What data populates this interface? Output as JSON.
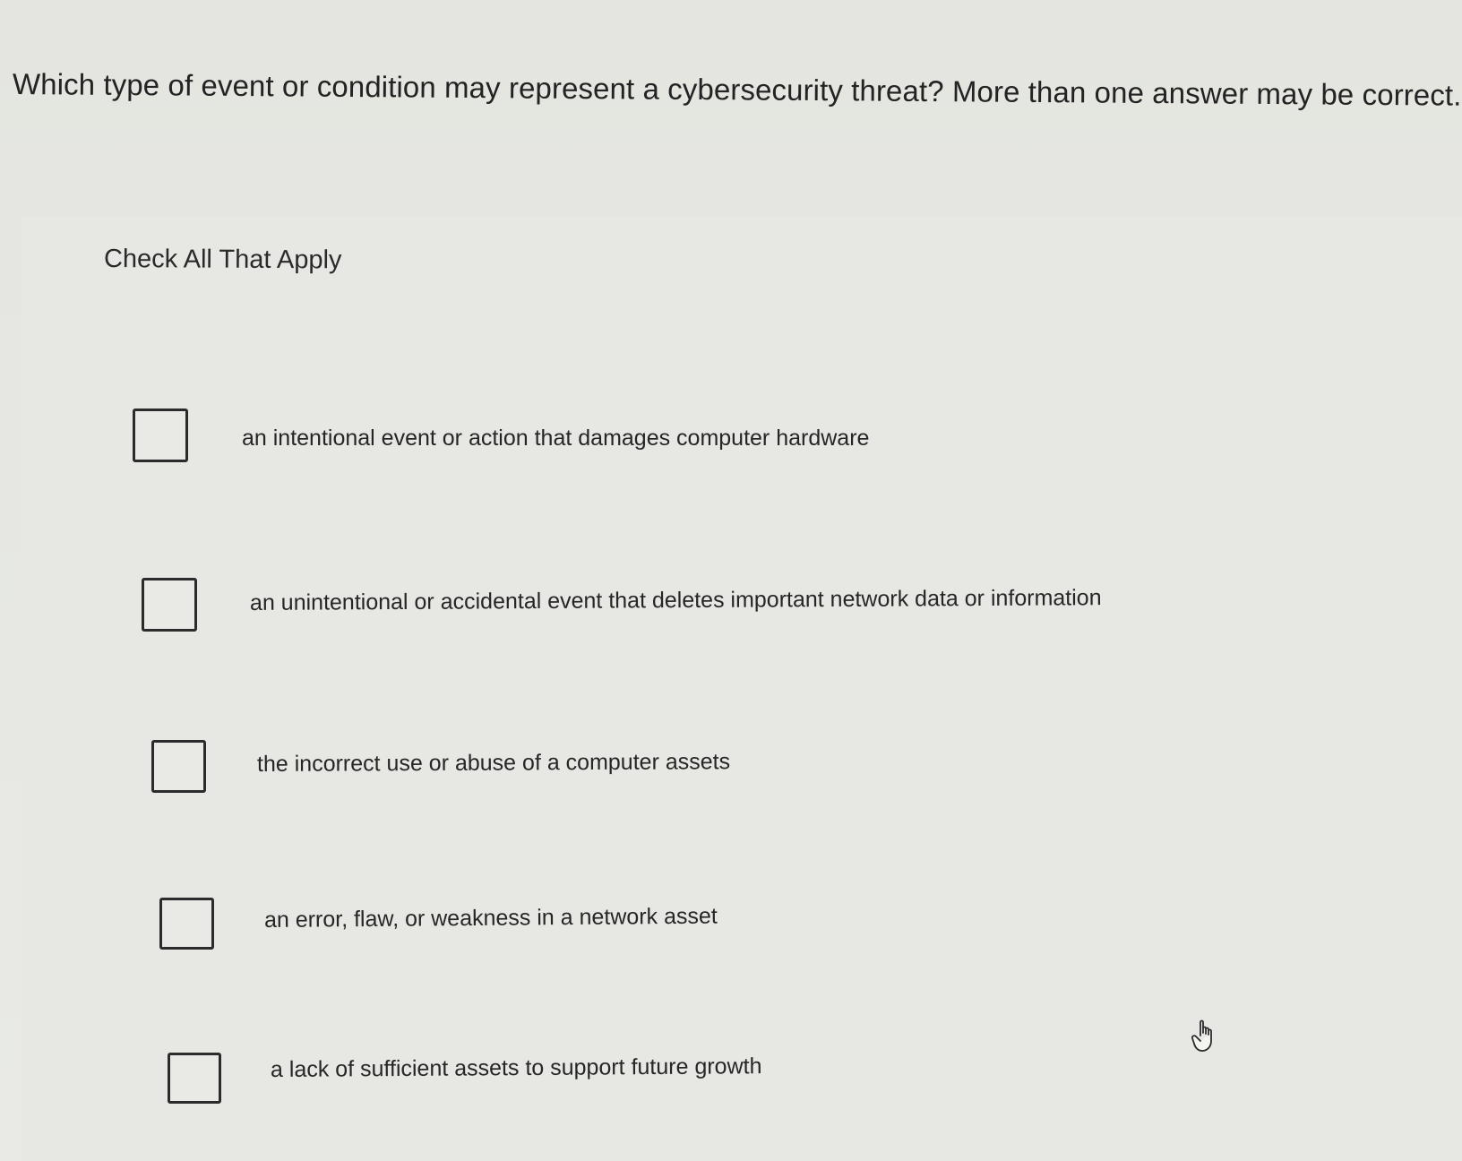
{
  "question": {
    "text": "Which type of event or condition may represent a cybersecurity threat? More than one answer may be correct."
  },
  "instruction": "Check All That Apply",
  "options": [
    {
      "label": "an intentional event or action that damages computer hardware",
      "checked": false
    },
    {
      "label": "an unintentional or accidental event that deletes important network data or information",
      "checked": false
    },
    {
      "label": "the incorrect use or abuse of a computer assets",
      "checked": false
    },
    {
      "label": "an error, flaw, or weakness in a network asset",
      "checked": false
    },
    {
      "label": "a lack of sufficient assets to support future growth",
      "checked": false
    }
  ],
  "cursor": {
    "icon": "hand-pointer-icon"
  }
}
